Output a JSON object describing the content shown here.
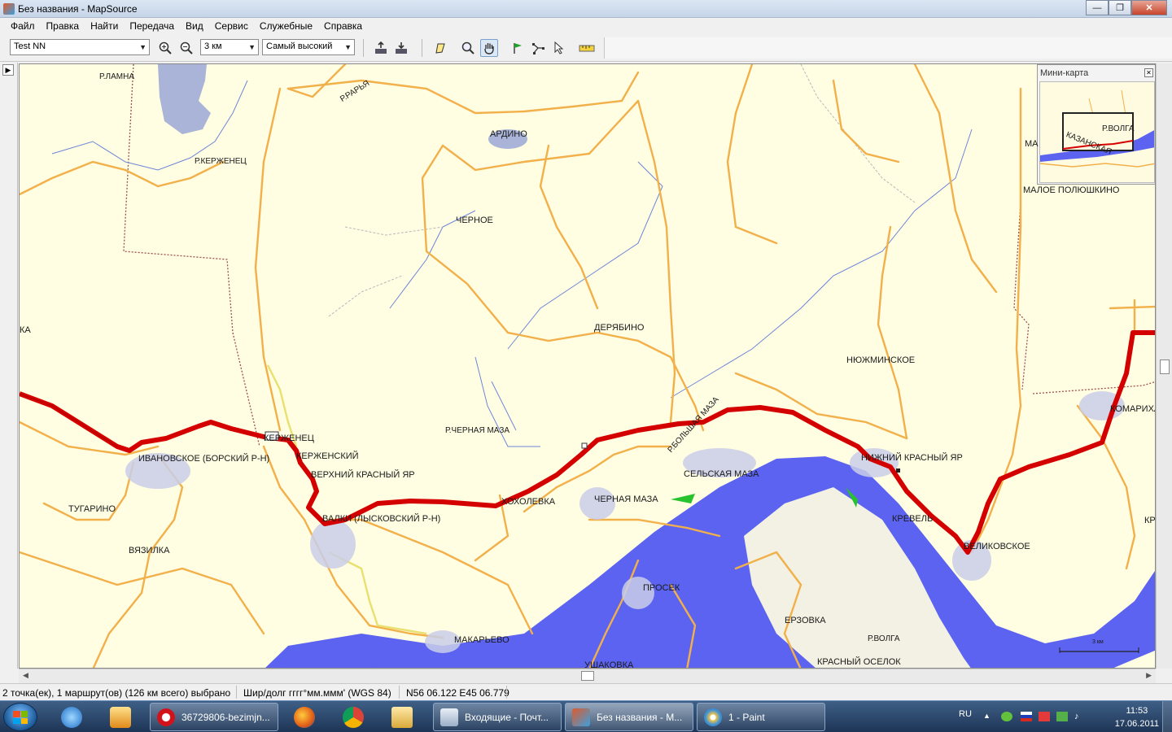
{
  "window": {
    "title": "Без названия - MapSource",
    "buttons": [
      "—",
      "❐",
      "✕"
    ]
  },
  "menu": [
    "Файл",
    "Правка",
    "Найти",
    "Передача",
    "Вид",
    "Сервис",
    "Служебные",
    "Справка"
  ],
  "toolbar": {
    "map_product": "Test NN",
    "zoom_scale": "3 км",
    "detail_level": "Самый высокий"
  },
  "minimap": {
    "title": "Мини-карта",
    "labels": [
      "Р.ВОЛГА",
      "КАЗАНСКАЯ",
      "МА"
    ]
  },
  "map": {
    "scale_text": "3 км",
    "places": [
      "Р.ЛАМНА",
      "Р.РАРЬЯ",
      "АРДИНО",
      "Р.КЕРЖЕНЕЦ",
      "ЧЕРНОЕ",
      "ДЕРЯБИНО",
      "КА",
      "НЮЖМИНСКОЕ",
      "МАЛОЕ ПОЛЮШКИНО",
      "Р.ЧЕРНАЯ МАЗА",
      "Р.БОЛЬШАЯ МАЗА",
      "КЕРЖЕНЕЦ",
      "КЕРЖЕНСКИЙ",
      "ИВАНОВСКОЕ (БОРСКИЙ Р-Н)",
      "ВЕРХНИЙ КРАСНЫЙ ЯР",
      "НИЖНИЙ КРАСНЫЙ ЯР",
      "КОМАРИХА",
      "СЕЛЬСКАЯ МАЗА",
      "ТУГАРИНО",
      "ВАЛКИ (ЛЫСКОВСКИЙ Р-Н)",
      "ХОХОЛЕВКА",
      "ЧЕРНАЯ МАЗА",
      "КРЕВЕЛЬ",
      "ВЕЛИКОВСКОЕ",
      "КРА",
      "ВЯЗИЛКА",
      "ПРОСЕК",
      "МАКАРЬЕВО",
      "ЕРЗОВКА",
      "Р.ВОЛГА",
      "УШАКОВКА",
      "КРАСНЫЙ ОСЕЛОК"
    ]
  },
  "status": {
    "selection": "2 точка(ек), 1 маршрут(ов) (126 км всего) выбрано",
    "format": "Шир/долг гггг°мм.ммм' (WGS 84)",
    "coords": "N56 06.122 E45 06.779"
  },
  "taskbar": {
    "tasks": [
      "36729806-bezimjn...",
      "Входящие - Почт...",
      "Без названия - M...",
      "1 - Paint"
    ],
    "lang": "RU",
    "time": "11:53",
    "date": "17.06.2011"
  },
  "colors": {
    "route": "#d40000",
    "river": "#5b63f0",
    "road": "#f2b04a",
    "map_bg": "#fffde2"
  }
}
